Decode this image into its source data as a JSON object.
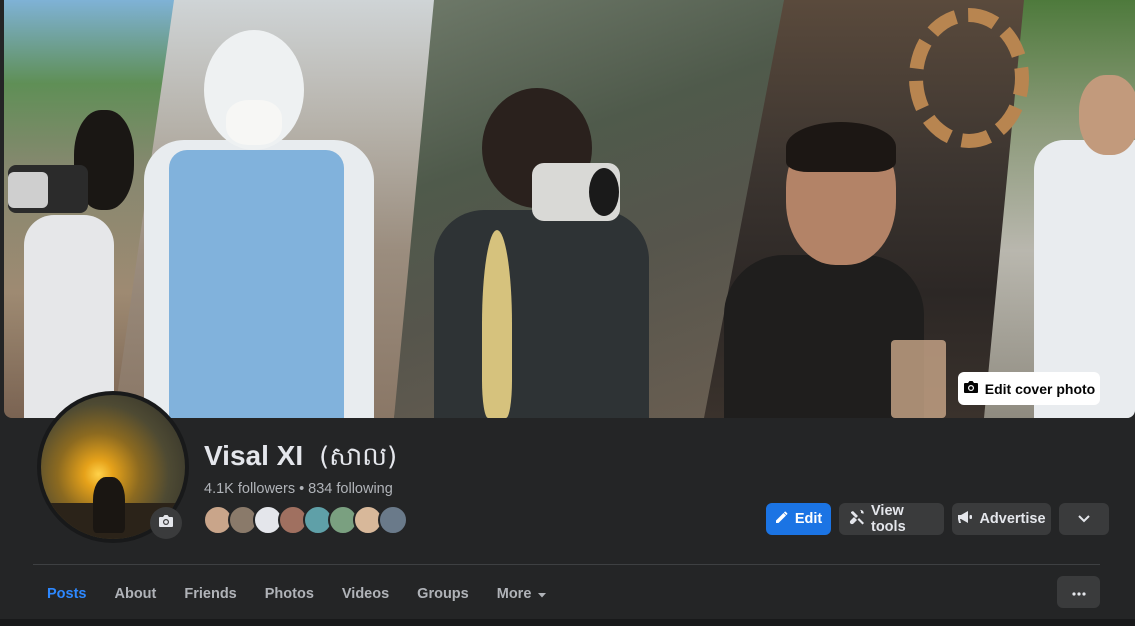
{
  "cover": {
    "edit_label": "Edit cover photo"
  },
  "profile": {
    "name": "Visal XI",
    "alternate_name": "(សាល)",
    "followers": "4.1K followers",
    "separator": "•",
    "following": "834 following"
  },
  "friend_avatars": [
    "#c9a58a",
    "#8a7a6a",
    "#e4e6eb",
    "#a07060",
    "#5fa0a8",
    "#7aa080",
    "#d8b89a",
    "#6a7a8a"
  ],
  "actions": {
    "edit_label": "Edit",
    "view_tools_label": "View tools",
    "advertise_label": "Advertise"
  },
  "tabs": [
    {
      "label": "Posts",
      "active": true
    },
    {
      "label": "About"
    },
    {
      "label": "Friends"
    },
    {
      "label": "Photos"
    },
    {
      "label": "Videos"
    },
    {
      "label": "Groups"
    },
    {
      "label": "More"
    }
  ],
  "colors": {
    "accent": "#1b74e4",
    "active_tab": "#2d88ff",
    "background": "#242526",
    "button_bg": "#3a3b3c"
  }
}
